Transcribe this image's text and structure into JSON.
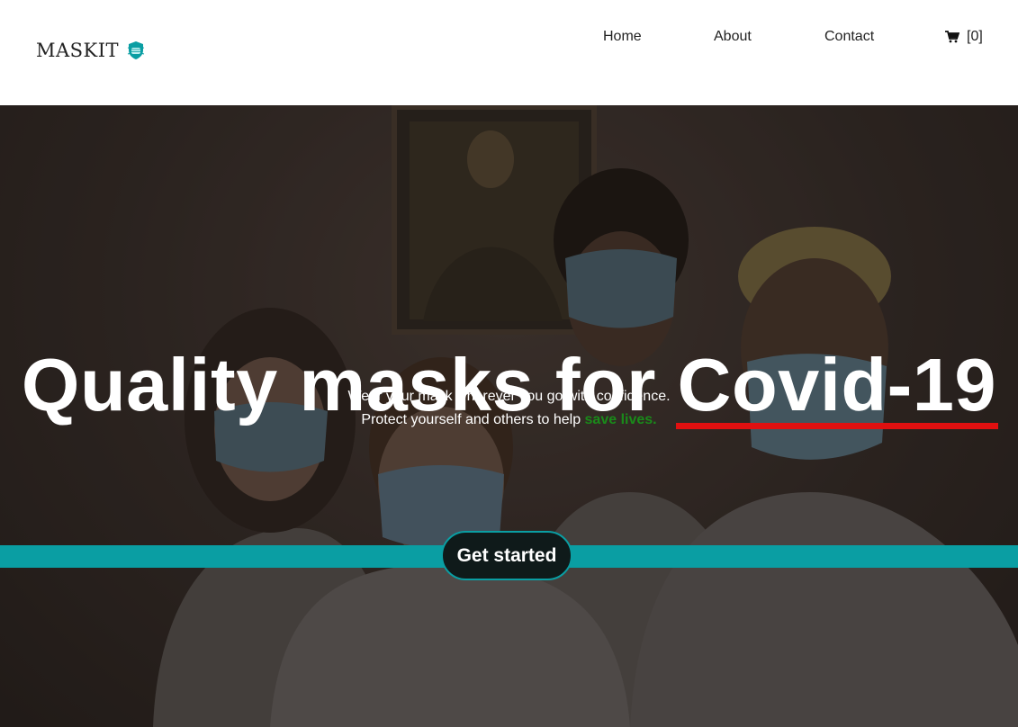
{
  "header": {
    "logo_text": "MASKIT",
    "logo_icon": "mask-shield-icon",
    "nav": {
      "home": "Home",
      "about": "About",
      "contact": "Contact"
    },
    "cart": {
      "icon": "cart-icon",
      "count": "[0]"
    }
  },
  "hero": {
    "headline_main": "Quality masks for ",
    "headline_highlight": "Covid-19",
    "subtitle_line1": "Wear your mask wherever you go with confidence.",
    "subtitle_line2_prefix": "Protect yourself and others to help ",
    "subtitle_line2_highlight": "save lives.",
    "cta_label": "Get started"
  },
  "colors": {
    "accent": "#0a9ea3",
    "highlight_underline": "#e01010",
    "save_lives_green": "#1a8a1a"
  }
}
